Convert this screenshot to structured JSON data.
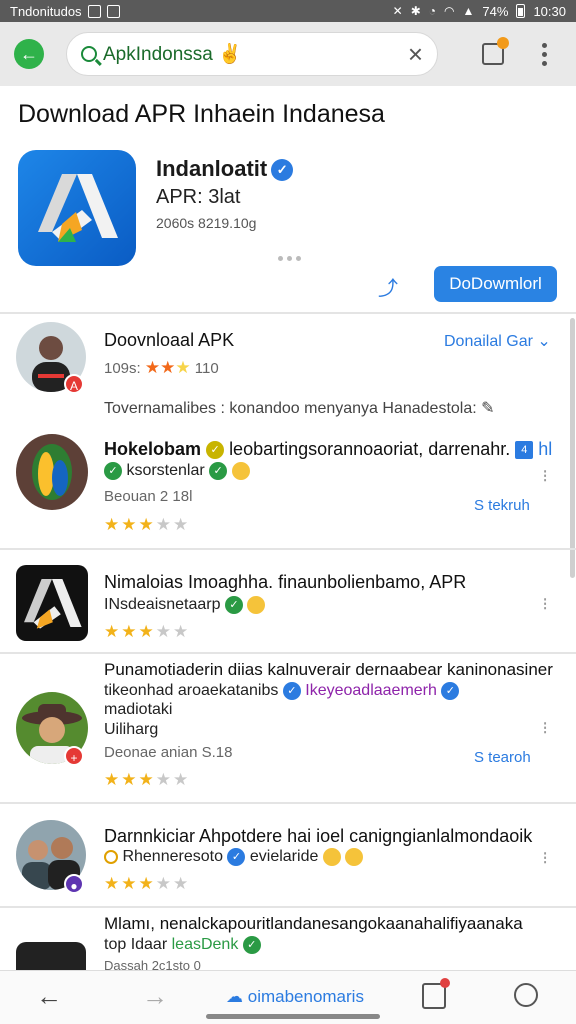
{
  "status_bar": {
    "app_label": "Tndonitudos",
    "icons": [
      "silent-icon",
      "bluetooth-icon",
      "alarm-icon",
      "wifi-icon",
      "signal-icon"
    ],
    "battery": "74%",
    "time": "10:30"
  },
  "browser": {
    "url_text": "ApkIndonssa",
    "url_emoji": "✌"
  },
  "page": {
    "title": "Download APR Inhaein Indanesa"
  },
  "app": {
    "name": "Indanloatit",
    "subtitle": "APR: 3lat",
    "meta": "2060s 8219.10g",
    "download_label": "DoDowmlorl"
  },
  "review_header": {
    "title": "Doovnloaal APK",
    "meta": "109s:",
    "rating_value": "110",
    "filter_label": "Donailal Gar"
  },
  "comment_summary": "Tovernamalibes : konandoo menyanya Hanadestola:",
  "items": [
    {
      "title": "Hokelobam",
      "title_rest": "leobartingsorannoaoriat, darrenahr.",
      "tag": "4",
      "tag_rest": "hl",
      "line2": "ksorstenlar",
      "meta": "Beouan 2 18l",
      "link": "S tekruh",
      "stars": 3
    },
    {
      "title": "Nimaloias Imoaghha. finaunbolienbamo, APR",
      "line2": "INsdeaisnetaarp",
      "stars": 3
    },
    {
      "title": "Punamotiaderin diias kalnuverair dernaabear kaninonasiner",
      "line2": "tikeonhad aroaekatanibs",
      "line2_rest": "Ikeyeoadlaaemerh",
      "line3": "madiotaki",
      "line4": "Uiliharg",
      "meta": "Deonae anian S.18",
      "link": "S tearoh",
      "stars": 3
    },
    {
      "title": "Darnnkiciar Ahpotdere hai ioel canigngianlalmondaoik",
      "line2": "Rhenneresoto",
      "line2_rest": "evielaride",
      "stars": 3
    },
    {
      "title": "Mlamı, nenalckapouritlandanesangokaanahalifiyaanaka",
      "line2": "top Idaar",
      "line2_rest": "leasDenk",
      "meta": "Dassah 2c1sto 0"
    }
  ],
  "bottom_nav": {
    "center_label": "oimabenomaris"
  },
  "colors": {
    "accent": "#2a83e3",
    "star": "#f2b21a",
    "url_green": "#1a6a2a"
  }
}
